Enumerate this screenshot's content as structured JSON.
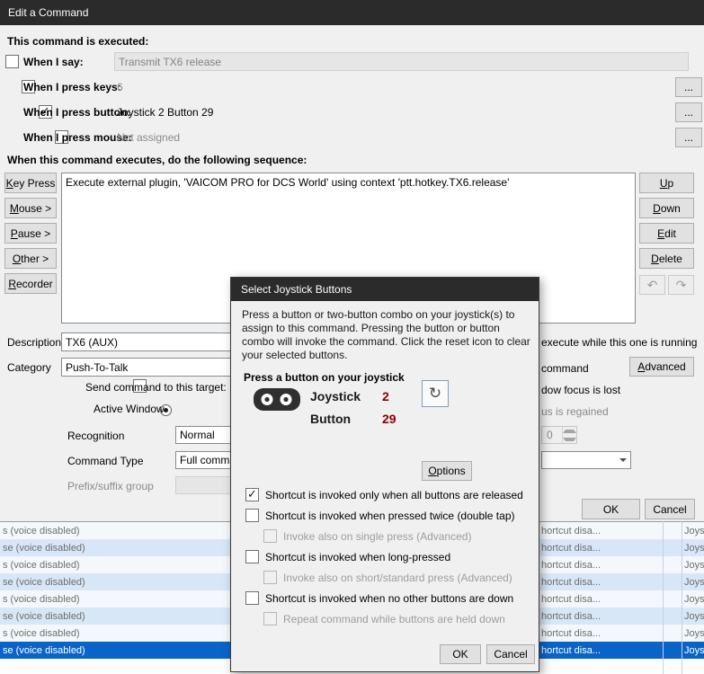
{
  "colors": {
    "titlebar": "#2b2b2b",
    "selection": "#0a64c8",
    "joystick_value_red": "#8b0000"
  },
  "window": {
    "title": "Edit a Command"
  },
  "ui": {
    "more": "...",
    "undo_icon": "↶",
    "redo_icon": "↷"
  },
  "triggers": {
    "heading": "This command is executed:",
    "say": {
      "label": "When I say:",
      "value": "Transmit TX6 release",
      "checked": false
    },
    "keys": {
      "label": "When I press keys:",
      "value": "6",
      "checked": false
    },
    "button": {
      "label": "When I press button:",
      "value": "Joystick 2 Button 29",
      "checked": true
    },
    "mouse": {
      "label": "When I press mouse:",
      "value": "Not assigned",
      "checked": false
    }
  },
  "sequence": {
    "heading": "When this command executes, do the following sequence:",
    "buttons": [
      "Key Press",
      "Mouse >",
      "Pause >",
      "Other >",
      "Recorder"
    ],
    "item": "Execute external plugin, 'VAICOM PRO for DCS World' using context 'ptt.hotkey.TX6.release'",
    "side_buttons": [
      "Up",
      "Down",
      "Edit",
      "Delete"
    ]
  },
  "details": {
    "description_label": "Description",
    "description_value": "TX6 (AUX)",
    "category_label": "Category",
    "category_value": "Push-To-Talk",
    "send_target_label": "Send command to this target:",
    "active_window_label": "Active Window",
    "active_window_selected": true,
    "recognition_label": "Recognition",
    "recognition_value": "Normal",
    "command_type_label": "Command Type",
    "command_type_value": "Full command",
    "prefix_label": "Prefix/suffix group"
  },
  "right_panel": {
    "running_fragment": "execute while this one is running",
    "command_fragment": "command",
    "advanced_label": "Advanced",
    "focus_lost_fragment": "dow focus is lost",
    "focus_regained_fragment": "us is regained",
    "spinner_value": "0"
  },
  "footer": {
    "ok": "OK",
    "cancel": "Cancel"
  },
  "command_list": {
    "rows": [
      {
        "name": "s  (voice disabled)",
        "shortcut": "hortcut disa...",
        "joystick": "Joys",
        "selected": false
      },
      {
        "name": "se  (voice disabled)",
        "shortcut": "hortcut disa...",
        "joystick": "Joys",
        "selected": false
      },
      {
        "name": "s  (voice disabled)",
        "shortcut": "hortcut disa...",
        "joystick": "Joys",
        "selected": false
      },
      {
        "name": "se  (voice disabled)",
        "shortcut": "hortcut disa...",
        "joystick": "Joys",
        "selected": false
      },
      {
        "name": "s  (voice disabled)",
        "shortcut": "hortcut disa...",
        "joystick": "Joys",
        "selected": false
      },
      {
        "name": "se  (voice disabled)",
        "shortcut": "hortcut disa...",
        "joystick": "Joys",
        "selected": false
      },
      {
        "name": "s  (voice disabled)",
        "shortcut": "hortcut disa...",
        "joystick": "Joys",
        "selected": false
      },
      {
        "name": "se  (voice disabled)",
        "shortcut": "hortcut disa...",
        "joystick": "Joys",
        "selected": true
      }
    ]
  },
  "joystick_dialog": {
    "title": "Select Joystick Buttons",
    "intro": "Press a button or two-button combo on your joystick(s) to assign to this command.  Pressing the button or button combo will invoke the command.  Click the reset icon to clear your selected buttons.",
    "press_heading": "Press a button on your joystick",
    "joystick_label": "Joystick",
    "joystick_value": "2",
    "button_label": "Button",
    "button_value": "29",
    "reset_icon": "↻",
    "options_label": "Options",
    "checkboxes": [
      {
        "label": "Shortcut is invoked only when all buttons are released",
        "checked": true,
        "enabled": true
      },
      {
        "label": "Shortcut is invoked when pressed twice (double tap)",
        "checked": false,
        "enabled": true
      },
      {
        "label": "Invoke also on single press (Advanced)",
        "checked": false,
        "enabled": false
      },
      {
        "label": "Shortcut is invoked when long-pressed",
        "checked": false,
        "enabled": true
      },
      {
        "label": "Invoke also on short/standard press (Advanced)",
        "checked": false,
        "enabled": false
      },
      {
        "label": "Shortcut is invoked when no other buttons are down",
        "checked": false,
        "enabled": true
      },
      {
        "label": "Repeat command while buttons are held down",
        "checked": false,
        "enabled": false
      }
    ],
    "ok": "OK",
    "cancel": "Cancel"
  }
}
